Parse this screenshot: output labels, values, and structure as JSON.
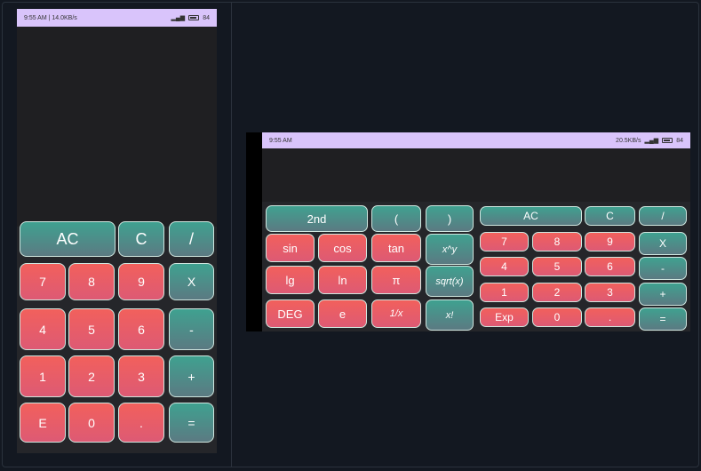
{
  "portrait": {
    "status": {
      "left": "9:55 AM | 14.0KB/s",
      "battery": "84"
    },
    "keys": [
      {
        "label": "AC",
        "style": "teal",
        "size": "big"
      },
      {
        "label": "C",
        "style": "teal",
        "size": "big"
      },
      {
        "label": "/",
        "style": "teal",
        "size": "big"
      },
      {
        "label": "7",
        "style": "red"
      },
      {
        "label": "8",
        "style": "red"
      },
      {
        "label": "9",
        "style": "red"
      },
      {
        "label": "X",
        "style": "teal"
      },
      {
        "label": "4",
        "style": "red"
      },
      {
        "label": "5",
        "style": "red"
      },
      {
        "label": "6",
        "style": "red"
      },
      {
        "label": "-",
        "style": "teal"
      },
      {
        "label": "1",
        "style": "red"
      },
      {
        "label": "2",
        "style": "red"
      },
      {
        "label": "3",
        "style": "red"
      },
      {
        "label": "+",
        "style": "teal"
      },
      {
        "label": "E",
        "style": "red"
      },
      {
        "label": "0",
        "style": "red"
      },
      {
        "label": ".",
        "style": "red"
      },
      {
        "label": "=",
        "style": "teal"
      }
    ]
  },
  "landscape": {
    "status": {
      "left": "9:55 AM",
      "right": "20.5KB/s",
      "battery": "84"
    },
    "scientific": [
      {
        "label": "2nd",
        "style": "teal"
      },
      {
        "label": "(",
        "style": "teal"
      },
      {
        "label": ")",
        "style": "teal"
      },
      {
        "label": "sin",
        "style": "red"
      },
      {
        "label": "cos",
        "style": "red"
      },
      {
        "label": "tan",
        "style": "red"
      },
      {
        "label": "x^y",
        "style": "teal",
        "italic": true
      },
      {
        "label": "lg",
        "style": "red"
      },
      {
        "label": "ln",
        "style": "red"
      },
      {
        "label": "π",
        "style": "red"
      },
      {
        "label": "sqrt(x)",
        "style": "teal",
        "italic": true
      },
      {
        "label": "DEG",
        "style": "red"
      },
      {
        "label": "e",
        "style": "red"
      },
      {
        "label": "1/x",
        "style": "red",
        "italic": true
      },
      {
        "label": "x!",
        "style": "teal",
        "italic": true
      }
    ],
    "basic": [
      {
        "label": "AC",
        "style": "teal"
      },
      {
        "label": "C",
        "style": "teal"
      },
      {
        "label": "/",
        "style": "teal"
      },
      {
        "label": "7",
        "style": "red"
      },
      {
        "label": "8",
        "style": "red"
      },
      {
        "label": "9",
        "style": "red"
      },
      {
        "label": "X",
        "style": "teal"
      },
      {
        "label": "4",
        "style": "red"
      },
      {
        "label": "5",
        "style": "red"
      },
      {
        "label": "6",
        "style": "red"
      },
      {
        "label": "-",
        "style": "teal"
      },
      {
        "label": "1",
        "style": "red"
      },
      {
        "label": "2",
        "style": "red"
      },
      {
        "label": "3",
        "style": "red"
      },
      {
        "label": "+",
        "style": "teal"
      },
      {
        "label": "Exp",
        "style": "red"
      },
      {
        "label": "0",
        "style": "red"
      },
      {
        "label": ".",
        "style": "red"
      },
      {
        "label": "=",
        "style": "teal"
      }
    ]
  },
  "colors": {
    "red_top": "#f2605c",
    "red_bottom": "#dd5a74",
    "teal_top": "#3fa190",
    "teal_bottom": "#5b7a82",
    "status_bar": "#d9c4fb",
    "background": "#131821"
  }
}
